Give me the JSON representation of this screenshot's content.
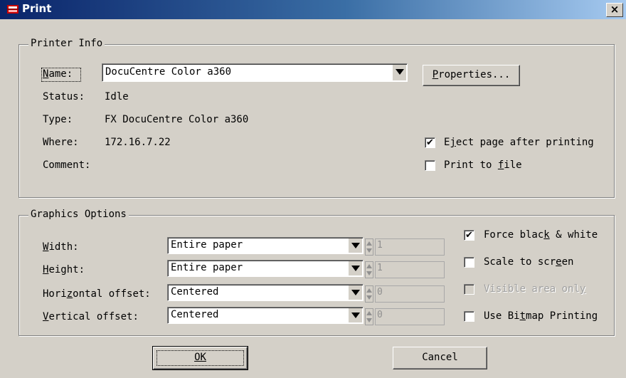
{
  "window": {
    "title": "Print",
    "close_glyph": "×"
  },
  "printer_info": {
    "legend": "Printer Info",
    "name_label": "Name:",
    "name_value": "DocuCentre Color a360",
    "properties_button": "Properties...",
    "status_label": "Status:",
    "status_value": "Idle",
    "type_label": "Type:",
    "type_value": "FX DocuCentre Color a360",
    "where_label": "Where:",
    "where_value": "172.16.7.22",
    "comment_label": "Comment:",
    "comment_value": "",
    "eject_label": "Eject page after printing",
    "eject_checked": true,
    "print_to_file_label": "Print to file",
    "print_to_file_checked": false
  },
  "graphics_options": {
    "legend": "Graphics Options",
    "width_label": "Width:",
    "width_value": "Entire paper",
    "width_spin": "1",
    "height_label": "Height:",
    "height_value": "Entire paper",
    "height_spin": "1",
    "hoffset_label": "Horizontal offset:",
    "hoffset_value": "Centered",
    "hoffset_spin": "0",
    "voffset_label": "Vertical offset:",
    "voffset_value": "Centered",
    "voffset_spin": "0",
    "force_bw_label": "Force black & white",
    "force_bw_checked": true,
    "scale_label": "Scale to screen",
    "scale_checked": false,
    "visible_area_label": "Visible area only",
    "visible_area_checked": false,
    "bitmap_label": "Use Bitmap Printing",
    "bitmap_checked": false
  },
  "buttons": {
    "ok": "OK",
    "cancel": "Cancel"
  },
  "icons": {
    "title": "printer-icon",
    "close": "close-icon",
    "dropdown": "chevron-down-icon",
    "spinner": "spinner-arrows-icon",
    "check": "checkmark-icon"
  },
  "colors": {
    "title_bar_start": "#0a246a",
    "title_bar_end": "#a6caf0",
    "face": "#d4d0c8"
  }
}
